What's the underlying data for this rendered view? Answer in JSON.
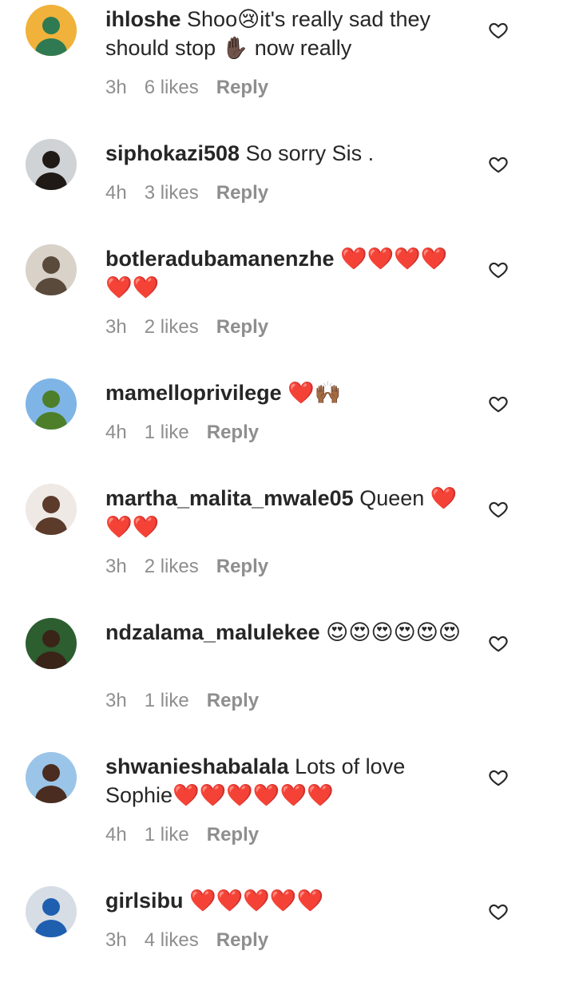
{
  "comments": [
    {
      "username": "ihloshe",
      "message": "Shoo😢it's really sad they should stop ✋🏿 now really",
      "time": "3h",
      "likes": "6 likes",
      "reply": "Reply",
      "avatar_colors": [
        "#f1b23b",
        "#2f7a52"
      ]
    },
    {
      "username": "siphokazi508",
      "message": "So sorry Sis .",
      "time": "4h",
      "likes": "3 likes",
      "reply": "Reply",
      "avatar_colors": [
        "#cfd3d6",
        "#1f1a16"
      ]
    },
    {
      "username": "botleradubamanenzhe",
      "message": "❤️❤️❤️❤️❤️❤️",
      "time": "3h",
      "likes": "2 likes",
      "reply": "Reply",
      "avatar_colors": [
        "#d8d2c8",
        "#5a4a3c"
      ]
    },
    {
      "username": "mamelloprivilege",
      "message": "❤️🙌🏾",
      "time": "4h",
      "likes": "1 like",
      "reply": "Reply",
      "avatar_colors": [
        "#7fb5e6",
        "#4d7f2a"
      ]
    },
    {
      "username": "martha_malita_mwale05",
      "message": "Queen ❤️❤️❤️",
      "time": "3h",
      "likes": "2 likes",
      "reply": "Reply",
      "avatar_colors": [
        "#efe9e6",
        "#5c3b2a"
      ]
    },
    {
      "username": "ndzalama_malulekee",
      "message": "😍😍😍😍😍😍",
      "time": "3h",
      "likes": "1 like",
      "reply": "Reply",
      "avatar_colors": [
        "#2c5e2f",
        "#3a2418"
      ]
    },
    {
      "username": "shwanieshabalala",
      "message": "Lots of love Sophie❤️❤️❤️❤️❤️❤️",
      "time": "4h",
      "likes": "1 like",
      "reply": "Reply",
      "avatar_colors": [
        "#9bc5e8",
        "#4a2d20"
      ]
    },
    {
      "username": "girlsibu",
      "message": "❤️❤️❤️❤️❤️",
      "time": "3h",
      "likes": "4 likes",
      "reply": "Reply",
      "avatar_colors": [
        "#d7dde4",
        "#1f5fb0"
      ]
    }
  ]
}
